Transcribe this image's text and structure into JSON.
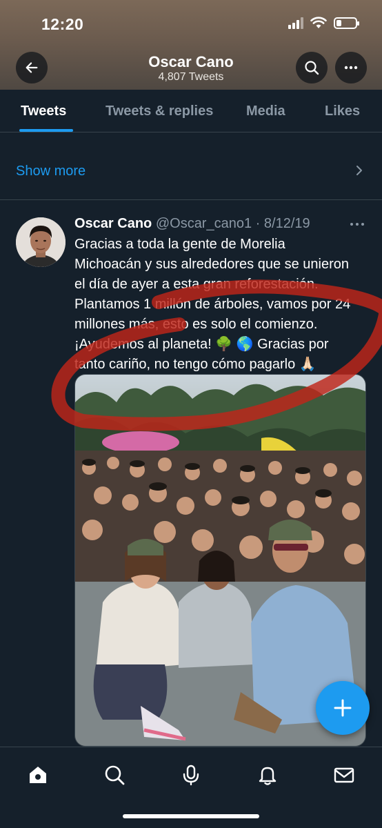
{
  "status_bar": {
    "time": "12:20"
  },
  "header": {
    "title": "Oscar Cano",
    "subtitle": "4,807 Tweets",
    "back_icon": "arrow-left-icon",
    "search_icon": "search-icon",
    "more_icon": "more-horizontal-icon"
  },
  "tabs": [
    {
      "label": "Tweets",
      "active": true
    },
    {
      "label": "Tweets & replies",
      "active": false
    },
    {
      "label": "Media",
      "active": false
    },
    {
      "label": "Likes",
      "active": false
    }
  ],
  "show_more": {
    "label": "Show more"
  },
  "tweet": {
    "author_name": "Oscar Cano",
    "handle": "@Oscar_cano1",
    "separator": "·",
    "date": "8/12/19",
    "text_lines": [
      "Gracias a toda la gente de Morelia",
      "Michoacán y sus alrededores que se unieron",
      "el día de ayer a esta gran reforestación.",
      "Plantamos 1 millón de árboles, vamos por 24",
      "millones más, esto es solo el comienzo.",
      "¡Ayudemos al planeta! 🌳 🌎 Gracias por",
      "tanto cariño, no tengo cómo pagarlo 🙏🏻"
    ]
  },
  "colors": {
    "background": "#15202b",
    "accent": "#1d9bf0",
    "secondary_text": "#8b98a5",
    "divider": "#38444d",
    "annotation_red": "#c0261a"
  },
  "bottom_nav": [
    {
      "icon": "home-icon"
    },
    {
      "icon": "search-icon"
    },
    {
      "icon": "spaces-microphone-icon"
    },
    {
      "icon": "notifications-bell-icon"
    },
    {
      "icon": "messages-envelope-icon"
    }
  ]
}
